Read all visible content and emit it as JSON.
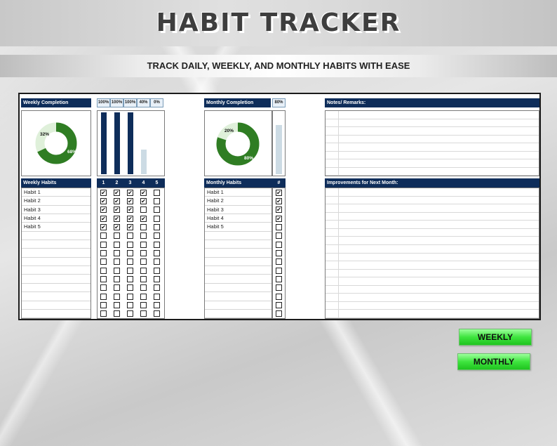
{
  "title": "HABIT TRACKER",
  "subtitle": "TRACK DAILY, WEEKLY, AND MONTHLY HABITS WITH EASE",
  "weekly": {
    "completion_header": "Weekly Completion",
    "donut": {
      "done_label": "68%",
      "remaining_label": "32%",
      "done": 68,
      "done_color": "#2f7d23",
      "remaining_color": "#dff0da"
    },
    "day_percents": [
      "100%",
      "100%",
      "100%",
      "40%",
      "0%"
    ],
    "day_values": [
      100,
      100,
      100,
      40,
      0
    ],
    "habits_header": "Weekly Habits",
    "day_numbers": [
      "1",
      "2",
      "3",
      "4",
      "5"
    ],
    "habits": [
      "Habit 1",
      "Habit 2",
      "Habit 3",
      "Habit 4",
      "Habit 5",
      "",
      "",
      "",
      "",
      "",
      "",
      "",
      "",
      "",
      ""
    ],
    "checks": [
      [
        true,
        true,
        true,
        true,
        false
      ],
      [
        true,
        true,
        true,
        true,
        false
      ],
      [
        true,
        true,
        true,
        false,
        false
      ],
      [
        true,
        true,
        true,
        true,
        false
      ],
      [
        true,
        true,
        true,
        false,
        false
      ],
      [
        false,
        false,
        false,
        false,
        false
      ],
      [
        false,
        false,
        false,
        false,
        false
      ],
      [
        false,
        false,
        false,
        false,
        false
      ],
      [
        false,
        false,
        false,
        false,
        false
      ],
      [
        false,
        false,
        false,
        false,
        false
      ],
      [
        false,
        false,
        false,
        false,
        false
      ],
      [
        false,
        false,
        false,
        false,
        false
      ],
      [
        false,
        false,
        false,
        false,
        false
      ],
      [
        false,
        false,
        false,
        false,
        false
      ],
      [
        false,
        false,
        false,
        false,
        false
      ]
    ]
  },
  "monthly": {
    "completion_header": "Monthly Completion",
    "percent": "80%",
    "percent_value": 80,
    "donut": {
      "done_label": "80%",
      "remaining_label": "20%",
      "done": 80,
      "done_color": "#2f7d23",
      "remaining_color": "#dff0da"
    },
    "habits_header": "Monthly Habits",
    "hash_header": "#",
    "habits": [
      "Habit 1",
      "Habit 2",
      "Habit 3",
      "Habit 4",
      "Habit 5",
      "",
      "",
      "",
      "",
      "",
      "",
      "",
      "",
      "",
      ""
    ],
    "checks": [
      true,
      true,
      true,
      true,
      false,
      false,
      false,
      false,
      false,
      false,
      false,
      false,
      false,
      false,
      false
    ]
  },
  "notes": {
    "header": "Notes/ Remarks:",
    "lines": 8
  },
  "improvements": {
    "header": "Improvements for Next Month:",
    "lines": 16
  },
  "buttons": {
    "weekly": "WEEKLY",
    "monthly": "MONTHLY"
  },
  "colors": {
    "navy": "#0e2d5a",
    "bar_done": "#0e2d5a",
    "bar_partial": "#ccdbe4",
    "button_green": "#3ee43e"
  },
  "check_glyph": "✔"
}
